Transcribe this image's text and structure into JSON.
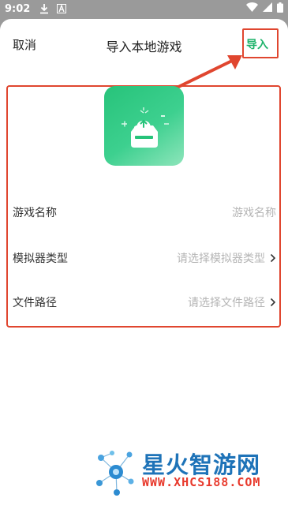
{
  "status_bar": {
    "time": "9:02",
    "icons": [
      "download-icon",
      "font-a-icon",
      "wifi-icon",
      "signal-icon",
      "battery-icon"
    ]
  },
  "header": {
    "cancel_label": "取消",
    "title": "导入本地游戏",
    "import_label": "导入"
  },
  "form": {
    "game_name": {
      "label": "游戏名称",
      "placeholder": "游戏名称"
    },
    "emulator_type": {
      "label": "模拟器类型",
      "placeholder": "请选择模拟器类型"
    },
    "file_path": {
      "label": "文件路径",
      "placeholder": "请选择文件路径"
    }
  },
  "watermark": {
    "title": "星火智游网",
    "url": "WWW.XHCS188.COM"
  },
  "colors": {
    "accent_green": "#1fb36b",
    "highlight_red": "#e0462f",
    "icon_gradient_start": "#27c37a",
    "icon_gradient_end": "#8ee5bb"
  }
}
